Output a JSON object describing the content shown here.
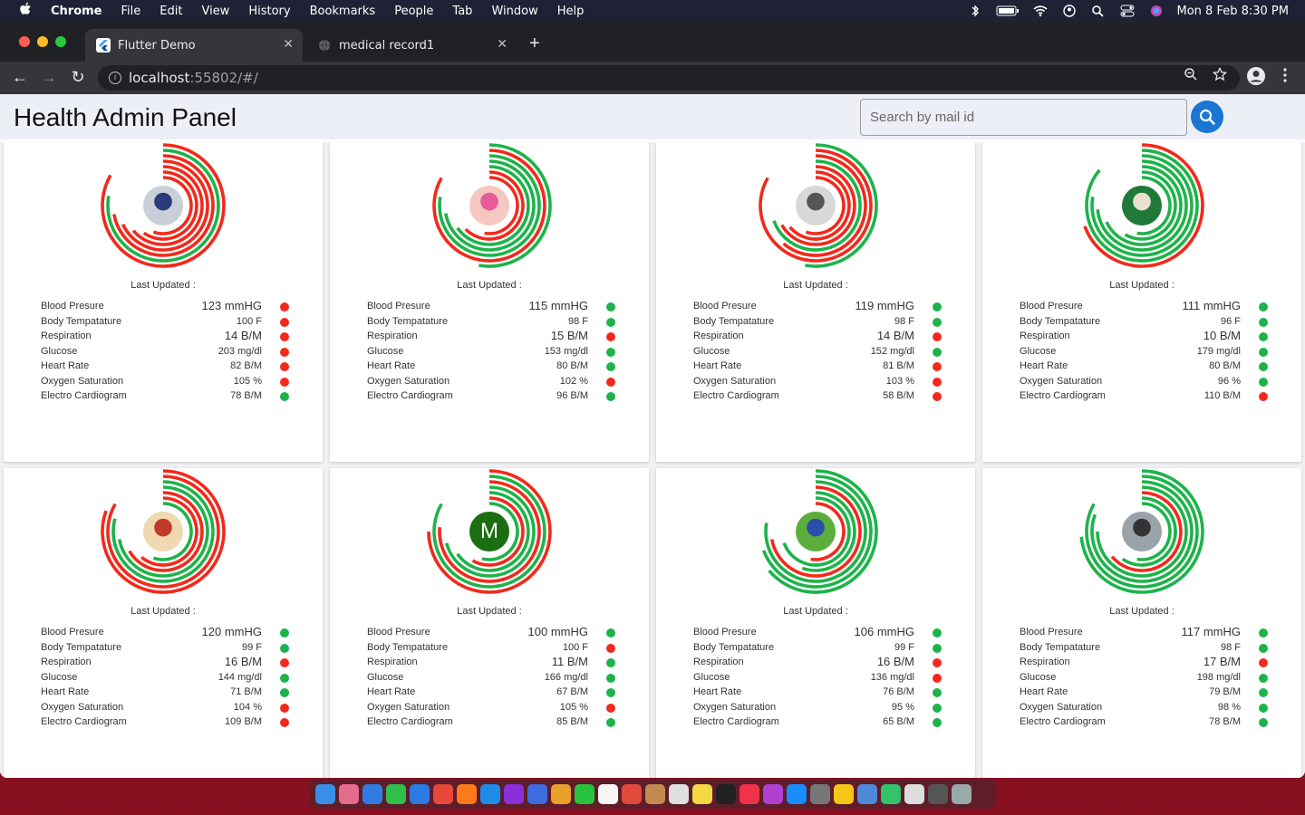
{
  "menubar": {
    "app": "Chrome",
    "items": [
      "File",
      "Edit",
      "View",
      "History",
      "Bookmarks",
      "People",
      "Tab",
      "Window",
      "Help"
    ],
    "clock": "Mon 8 Feb  8:30 PM"
  },
  "browser": {
    "tabs": [
      {
        "title": "Flutter Demo",
        "active": true
      },
      {
        "title": "medical record1",
        "active": false
      }
    ],
    "url_host": "localhost",
    "url_rest": ":55802/#/"
  },
  "app": {
    "title": "Health Admin Panel",
    "search_placeholder": "Search by mail id",
    "last_updated_label": "Last Updated :",
    "vital_labels": [
      "Blood Presure",
      "Body Tempatature",
      "Respiration",
      "Glucose",
      "Heart Rate",
      "Oxygen Saturation",
      "Electro Cardiogram"
    ],
    "colors": {
      "ok": "#1db34a",
      "bad": "#f2291b"
    },
    "patients": [
      {
        "avatar": "photo-man-standing",
        "values": [
          "123 mmHG",
          "100 F",
          "14 B/M",
          "203 mg/dl",
          "82 B/M",
          "105 %",
          "78 B/M"
        ],
        "status": [
          "bad",
          "bad",
          "bad",
          "bad",
          "bad",
          "bad",
          "ok"
        ]
      },
      {
        "avatar": "photo-woman-pink",
        "values": [
          "115 mmHG",
          "98 F",
          "15 B/M",
          "153 mg/dl",
          "80 B/M",
          "102 %",
          "96 B/M"
        ],
        "status": [
          "ok",
          "ok",
          "bad",
          "ok",
          "ok",
          "bad",
          "ok"
        ]
      },
      {
        "avatar": "photo-laptop",
        "values": [
          "119 mmHG",
          "98 F",
          "14 B/M",
          "152 mg/dl",
          "81 B/M",
          "103 %",
          "58 B/M"
        ],
        "status": [
          "ok",
          "ok",
          "bad",
          "ok",
          "bad",
          "bad",
          "bad"
        ]
      },
      {
        "avatar": "photo-man-green",
        "values": [
          "111 mmHG",
          "96 F",
          "10 B/M",
          "179 mg/dl",
          "80 B/M",
          "96 %",
          "110 B/M"
        ],
        "status": [
          "ok",
          "ok",
          "ok",
          "ok",
          "ok",
          "ok",
          "bad"
        ]
      },
      {
        "avatar": "photo-woman-hat",
        "values": [
          "120 mmHG",
          "99 F",
          "16 B/M",
          "144 mg/dl",
          "71 B/M",
          "104 %",
          "109 B/M"
        ],
        "status": [
          "ok",
          "ok",
          "bad",
          "ok",
          "ok",
          "bad",
          "bad"
        ]
      },
      {
        "avatar": "letter-M",
        "initial": "M",
        "values": [
          "100 mmHG",
          "100 F",
          "11 B/M",
          "166 mg/dl",
          "67 B/M",
          "105 %",
          "85 B/M"
        ],
        "status": [
          "ok",
          "bad",
          "ok",
          "ok",
          "ok",
          "bad",
          "ok"
        ]
      },
      {
        "avatar": "photo-man-field",
        "values": [
          "106 mmHG",
          "99 F",
          "16 B/M",
          "136 mg/dl",
          "76 B/M",
          "95 %",
          "65 B/M"
        ],
        "status": [
          "ok",
          "ok",
          "bad",
          "bad",
          "ok",
          "ok",
          "ok"
        ]
      },
      {
        "avatar": "photo-camera",
        "values": [
          "117 mmHG",
          "98 F",
          "17 B/M",
          "198 mg/dl",
          "79 B/M",
          "98 %",
          "78 B/M"
        ],
        "status": [
          "ok",
          "ok",
          "bad",
          "ok",
          "ok",
          "ok",
          "ok"
        ]
      }
    ]
  }
}
